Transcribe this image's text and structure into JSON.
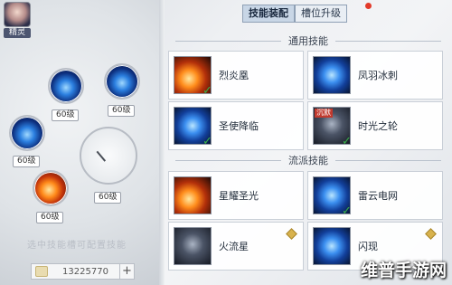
{
  "sprite_label": "精灵",
  "orbs": [
    {
      "label": "60级",
      "style": "blue"
    },
    {
      "label": "60级",
      "style": "blue"
    },
    {
      "label": "60级",
      "style": "blue"
    },
    {
      "label": "60级",
      "style": "fire"
    },
    {
      "label": "60级",
      "style": "dial"
    }
  ],
  "hint_text": "选中技能槽可配置技能",
  "currency": {
    "value": "13225770",
    "plus": "+"
  },
  "tabs": [
    {
      "label": "技能装配",
      "active": true
    },
    {
      "label": "槽位升级",
      "active": false
    }
  ],
  "sections": {
    "general": "通用技能",
    "school": "流派技能"
  },
  "skills": [
    {
      "name": "烈炎凰",
      "icon": "fire",
      "checked": true
    },
    {
      "name": "凤羽冰刺",
      "icon": "blue",
      "checked": false
    },
    {
      "name": "圣使降临",
      "icon": "blue",
      "checked": true
    },
    {
      "name": "时光之轮",
      "icon": "dark",
      "checked": true,
      "badge": "沉默"
    },
    {
      "name": "星耀圣光",
      "icon": "fire",
      "checked": false
    },
    {
      "name": "雷云电网",
      "icon": "blue",
      "checked": true
    },
    {
      "name": "火流星",
      "icon": "dark",
      "checked": false,
      "gem": true
    },
    {
      "name": "闪现",
      "icon": "blue",
      "checked": false,
      "gem": true
    }
  ],
  "watermark": "维普手游网"
}
